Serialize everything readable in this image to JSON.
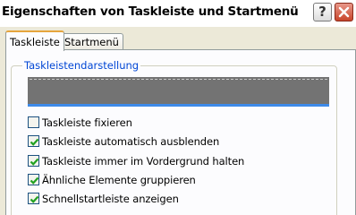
{
  "window": {
    "title": "Eigenschaften von Taskleiste und Startmenü",
    "help_label": "?"
  },
  "tabs": [
    {
      "label": "Taskleiste",
      "active": true
    },
    {
      "label": "Startmenü",
      "active": false
    }
  ],
  "group": {
    "label": "Taskleistendarstellung"
  },
  "options": [
    {
      "label": "Taskleiste fixieren",
      "checked": false
    },
    {
      "label": "Taskleiste automatisch ausblenden",
      "checked": true
    },
    {
      "label": "Taskleiste immer im Vordergrund halten",
      "checked": true
    },
    {
      "label": "Ähnliche Elemente gruppieren",
      "checked": true
    },
    {
      "label": "Schnellstartleiste anzeigen",
      "checked": true
    }
  ],
  "colors": {
    "accent": "#0046d5",
    "check": "#21a121",
    "close": "#c8452b"
  }
}
